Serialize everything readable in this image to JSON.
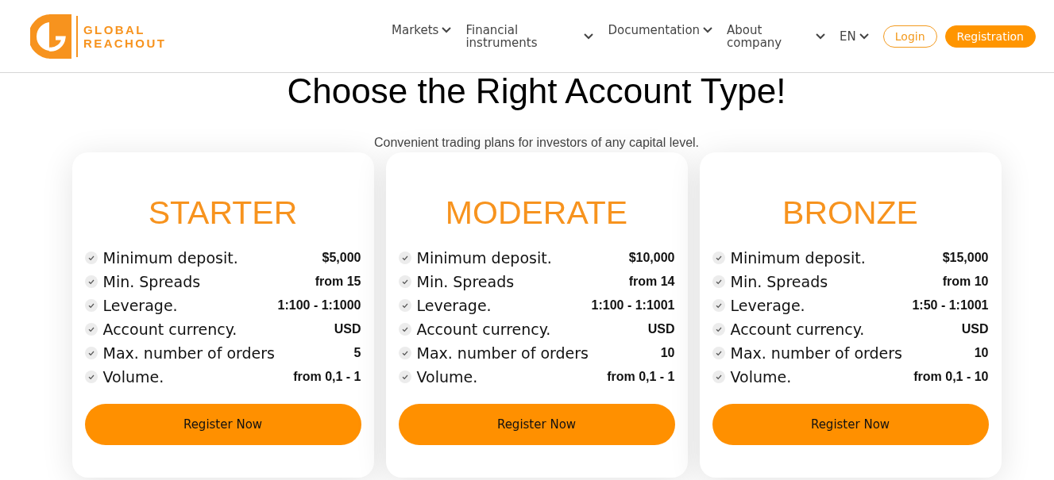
{
  "header": {
    "brand": "GLOBAL REACHOUT",
    "nav": [
      "Markets",
      "Financial instruments",
      "Documentation",
      "About company"
    ],
    "language": "EN",
    "buttons": [
      {
        "label": "Login",
        "kind": "outline"
      },
      {
        "label": "Registration",
        "kind": "filled"
      }
    ]
  },
  "section": {
    "title": "Choose the Right Account Type!",
    "subtitle": "Convenient trading plans for investors of any capital level."
  },
  "plans": [
    {
      "name": "STARTER",
      "features": [
        {
          "label": "Minimum deposit.",
          "value": "$5,000"
        },
        {
          "label": "Min. Spreads",
          "value": "from 15"
        },
        {
          "label": "Leverage.",
          "value": "1:100 - 1:1000"
        },
        {
          "label": "Account currency.",
          "value": "USD"
        },
        {
          "label": "Max. number of orders",
          "value": "5"
        },
        {
          "label": "Volume.",
          "value": "from 0,1 - 1"
        }
      ],
      "button": "Register Now"
    },
    {
      "name": "MODERATE",
      "features": [
        {
          "label": "Minimum deposit.",
          "value": "$10,000"
        },
        {
          "label": "Min. Spreads",
          "value": "from 14"
        },
        {
          "label": "Leverage.",
          "value": "1:100 - 1:1001"
        },
        {
          "label": "Account currency.",
          "value": "USD"
        },
        {
          "label": "Max. number of orders",
          "value": "10"
        },
        {
          "label": "Volume.",
          "value": "from 0,1 - 1"
        }
      ],
      "button": "Register Now"
    },
    {
      "name": "BRONZE",
      "features": [
        {
          "label": "Minimum deposit.",
          "value": "$15,000"
        },
        {
          "label": "Min. Spreads",
          "value": "from 10"
        },
        {
          "label": "Leverage.",
          "value": "1:50 - 1:1001"
        },
        {
          "label": "Account currency.",
          "value": "USD"
        },
        {
          "label": "Max. number of orders",
          "value": "10"
        },
        {
          "label": "Volume.",
          "value": "from 0,1 - 10"
        }
      ],
      "button": "Register Now"
    }
  ]
}
